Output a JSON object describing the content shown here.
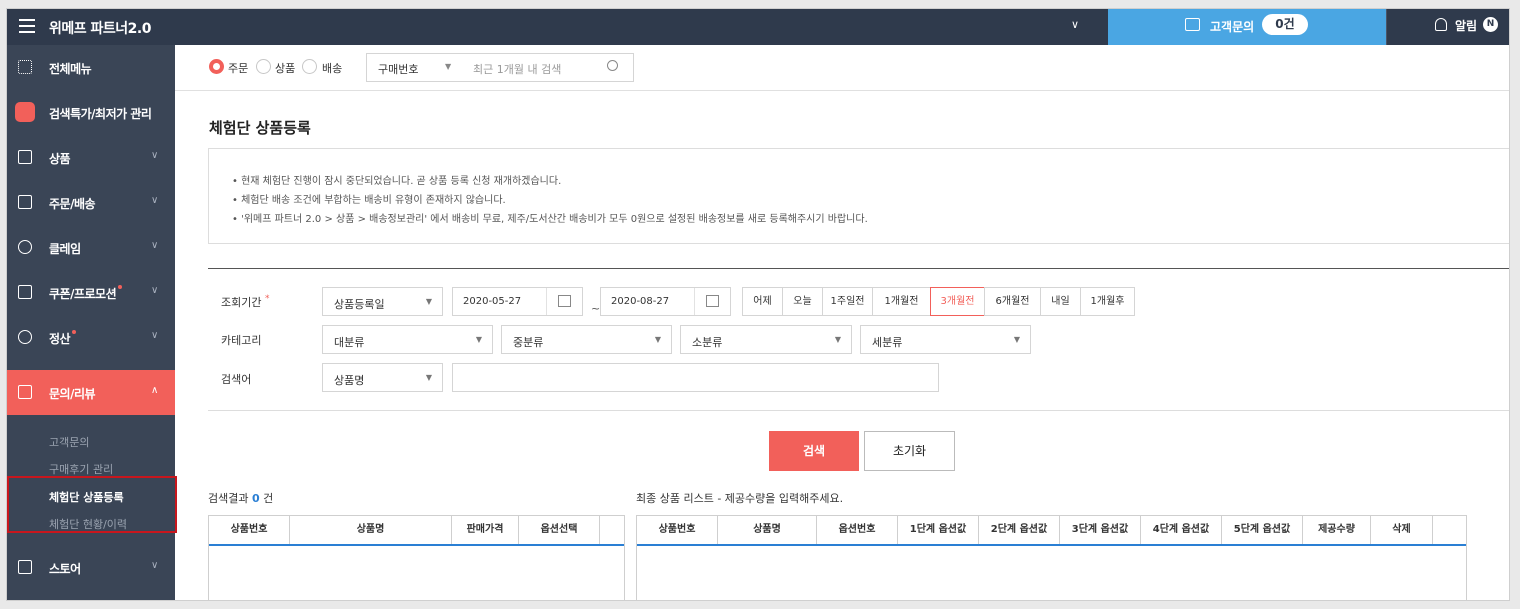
{
  "topbar": {
    "brand": "위메프 파트너2.0",
    "inquiry_label": "고객문의",
    "inquiry_count": "0건",
    "alarm_label": "알림",
    "alarm_badge": "N"
  },
  "sidebar": {
    "items": [
      {
        "label": "전체메뉴"
      },
      {
        "label": "검색특가/최저가 관리"
      },
      {
        "label": "상품"
      },
      {
        "label": "주문/배송"
      },
      {
        "label": "클레임"
      },
      {
        "label": "쿠폰/프로모션"
      },
      {
        "label": "정산"
      },
      {
        "label": "문의/리뷰"
      },
      {
        "label": "스토어"
      }
    ],
    "subitems": [
      {
        "label": "고객문의"
      },
      {
        "label": "구매후기 관리"
      },
      {
        "label": "체험단 상품등록"
      },
      {
        "label": "체험단 현황/이력"
      }
    ]
  },
  "searchbar": {
    "radio_order": "주문",
    "radio_product": "상품",
    "radio_delivery": "배송",
    "type_select": "구매번호",
    "placeholder": "최근 1개월 내 검색"
  },
  "page": {
    "title": "체험단 상품등록",
    "notices": [
      "• 현재 체험단 진행이 잠시 중단되었습니다. 곧 상품 등록 신청 재개하겠습니다.",
      "• 체험단 배송 조건에 부합하는 배송비 유형이 존재하지 않습니다.",
      "• '위메프 파트너 2.0 > 상품 > 배송정보관리' 에서 배송비 무료, 제주/도서산간 배송비가 모두 0원으로 설정된 배송정보를 새로 등록해주시기 바랍니다."
    ]
  },
  "filters": {
    "period_label": "조회기간",
    "required_mark": "*",
    "period_type": "상품등록일",
    "date_from": "2020-05-27",
    "tilde": "~",
    "date_to": "2020-08-27",
    "period_buttons": [
      "어제",
      "오늘",
      "1주일전",
      "1개월전",
      "3개월전",
      "6개월전",
      "내일",
      "1개월후"
    ],
    "category_label": "카테고리",
    "cat1": "대분류",
    "cat2": "중분류",
    "cat3": "소분류",
    "cat4": "세분류",
    "keyword_label": "검색어",
    "keyword_type": "상품명",
    "search_button": "검색",
    "reset_button": "초기화"
  },
  "results": {
    "prefix": "검색결과",
    "count": "0",
    "suffix": "건",
    "final_list_label": "최종 상품 리스트 - 제공수량을 입력해주세요.",
    "left_headers": [
      "상품번호",
      "상품명",
      "판매가격",
      "옵션선택"
    ],
    "right_headers": [
      "상품번호",
      "상품명",
      "옵션번호",
      "1단계 옵션값",
      "2단계 옵션값",
      "3단계 옵션값",
      "4단계 옵션값",
      "5단계 옵션값",
      "제공수량",
      "삭제"
    ]
  },
  "colors": {
    "accent": "#f2605a",
    "topbar": "#2f3a4c",
    "sidebar": "#3a4556",
    "inquiry": "#4aa6e3",
    "link_blue": "#2a7fd4"
  }
}
